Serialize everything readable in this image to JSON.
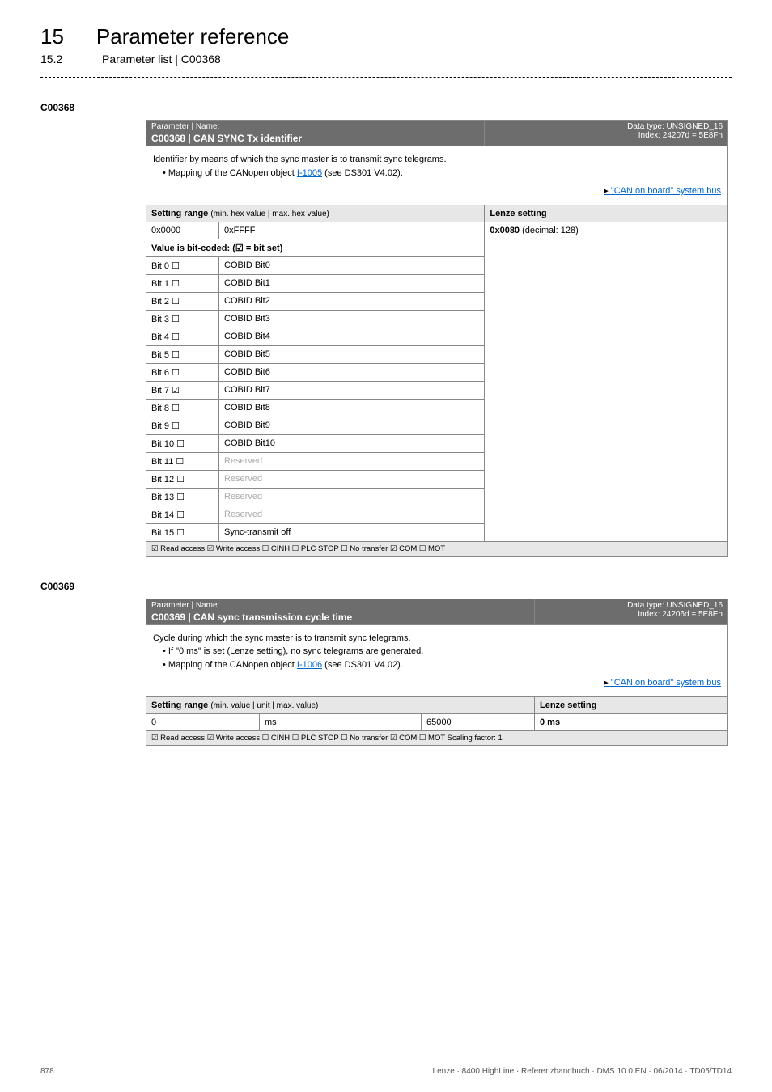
{
  "header": {
    "chapter_num": "15",
    "chapter_title": "Parameter reference",
    "section_num": "15.2",
    "section_title": "Parameter list | C00368"
  },
  "p1": {
    "id": "C00368",
    "head_left_top": "Parameter | Name:",
    "head_left_name": "C00368 | CAN SYNC Tx identifier",
    "head_right_l1": "Data type: UNSIGNED_16",
    "head_right_l2": "Index: 24207d = 5E8Fh",
    "desc_line1": "Identifier by means of which the sync master is to transmit sync telegrams.",
    "desc_bullet_pre": "• Mapping of the CANopen object ",
    "desc_bullet_link": "I-1005",
    "desc_bullet_post": " (see DS301 V4.02).",
    "syslink": "\"CAN on board\" system bus",
    "setting_range_label": "Setting range ",
    "setting_range_sub": "(min. hex value | max. hex value)",
    "lenze_label": "Lenze setting",
    "row_min": "0x0000",
    "row_max": "0xFFFF",
    "row_lenze_bold": "0x0080",
    "row_lenze_rest": "  (decimal: 128)",
    "bitcoded_label": "Value is bit-coded:  (☑ = bit set)",
    "bits": [
      {
        "label": "Bit 0  ☐",
        "text": "COBID Bit0"
      },
      {
        "label": "Bit 1  ☐",
        "text": "COBID Bit1"
      },
      {
        "label": "Bit 2  ☐",
        "text": "COBID Bit2"
      },
      {
        "label": "Bit 3  ☐",
        "text": "COBID Bit3"
      },
      {
        "label": "Bit 4  ☐",
        "text": "COBID Bit4"
      },
      {
        "label": "Bit 5  ☐",
        "text": "COBID Bit5"
      },
      {
        "label": "Bit 6  ☐",
        "text": "COBID Bit6"
      },
      {
        "label": "Bit 7  ☑",
        "text": "COBID Bit7"
      },
      {
        "label": "Bit 8  ☐",
        "text": "COBID Bit8"
      },
      {
        "label": "Bit 9  ☐",
        "text": "COBID Bit9"
      },
      {
        "label": "Bit 10  ☐",
        "text": "COBID Bit10"
      },
      {
        "label": "Bit 11  ☐",
        "text": "Reserved"
      },
      {
        "label": "Bit 12  ☐",
        "text": "Reserved"
      },
      {
        "label": "Bit 13  ☐",
        "text": "Reserved"
      },
      {
        "label": "Bit 14  ☐",
        "text": "Reserved"
      },
      {
        "label": "Bit 15  ☐",
        "text": "Sync-transmit off"
      }
    ],
    "access": "☑ Read access   ☑ Write access   ☐ CINH   ☐ PLC STOP   ☐ No transfer   ☑ COM   ☐ MOT"
  },
  "p2": {
    "id": "C00369",
    "head_left_top": "Parameter | Name:",
    "head_left_name": "C00369 | CAN sync transmission cycle time",
    "head_right_l1": "Data type: UNSIGNED_16",
    "head_right_l2": "Index: 24206d = 5E8Eh",
    "desc_line1": "Cycle during which the sync master is to transmit sync telegrams.",
    "desc_bullet1": "• If \"0 ms\" is set (Lenze setting), no sync telegrams are generated.",
    "desc_bullet2_pre": "• Mapping of the CANopen object ",
    "desc_bullet2_link": "I-1006",
    "desc_bullet2_post": "  (see DS301 V4.02).",
    "syslink": "\"CAN on board\" system bus",
    "setting_range_label": "Setting range ",
    "setting_range_sub": "(min. value | unit | max. value)",
    "lenze_label": "Lenze setting",
    "row_min": "0",
    "row_unit": "ms",
    "row_max": "65000",
    "row_lenze": "0 ms",
    "access": "☑ Read access   ☑ Write access   ☐ CINH   ☐ PLC STOP   ☐ No transfer   ☑ COM   ☐ MOT     Scaling factor: 1"
  },
  "footer": {
    "page": "878",
    "text": "Lenze · 8400 HighLine · Referenzhandbuch · DMS 10.0 EN · 06/2014 · TD05/TD14"
  }
}
